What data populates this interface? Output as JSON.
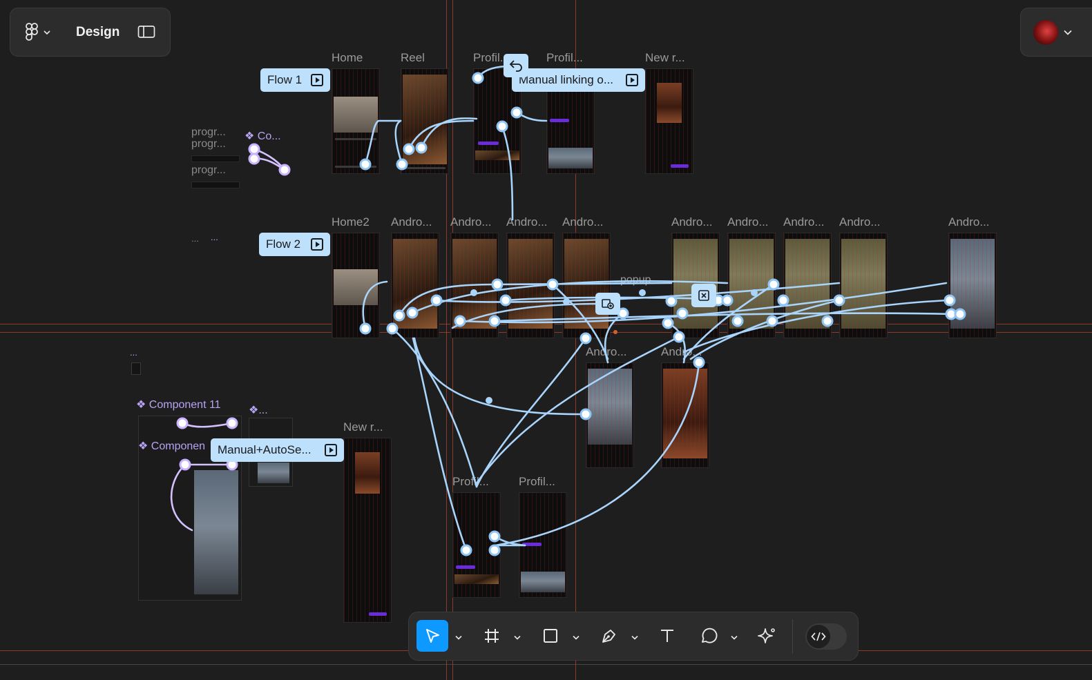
{
  "app": {
    "mode_label": "Design",
    "logo_icon": "figma-logo-icon",
    "sidebar_toggle_icon": "sidebar-toggle-icon",
    "avatar_icon": "user-avatar-icon"
  },
  "frames": {
    "row1": [
      "Home",
      "Reel",
      "Profil...",
      "Profil...",
      "New r..."
    ],
    "row2": [
      "Home2",
      "Andro...",
      "Andro...",
      "Andro...",
      "Andro...",
      "Andro...",
      "Andro...",
      "Andro...",
      "Andro...",
      "Andro..."
    ],
    "row3": [
      "Andro...",
      "Andro..."
    ],
    "row4": [
      "Profil...",
      "Profil..."
    ],
    "new_r2": "New r...",
    "popup": "popup"
  },
  "flows": {
    "flow1": "Flow 1",
    "flow2": "Flow 2",
    "manual_linking": "Manual linking o...",
    "manual_autosearch": "Manual+AutoSe..."
  },
  "components": {
    "co": "Co...",
    "component11": "Component 11",
    "component_b": "Componen",
    "comp_dot": "..."
  },
  "misc": {
    "progr1": "progr...",
    "progr2": "progr...",
    "progr3": "progr...",
    "dots1": "...",
    "dots2": "...",
    "dots3": "..."
  },
  "toolbar": {
    "tools": [
      {
        "name": "move-tool",
        "icon": "cursor-icon",
        "active": true
      },
      {
        "name": "frame-tool",
        "icon": "frame-hash-icon",
        "active": false
      },
      {
        "name": "rectangle-tool",
        "icon": "square-icon",
        "active": false
      },
      {
        "name": "pen-tool",
        "icon": "pen-icon",
        "active": false
      },
      {
        "name": "text-tool",
        "icon": "text-t-icon",
        "active": false
      },
      {
        "name": "comment-tool",
        "icon": "comment-bubble-icon",
        "active": false
      },
      {
        "name": "ai-tool",
        "icon": "sparkle-icon",
        "active": false
      }
    ],
    "dev_mode_icon": "code-brackets-icon"
  },
  "colors": {
    "canvas": "#1e1e1e",
    "flow_chip": "#bde0fd",
    "connector": "#a9d4fb",
    "component": "#b9a3f5",
    "active_tool": "#0d99ff",
    "guide": "#b5432f"
  }
}
